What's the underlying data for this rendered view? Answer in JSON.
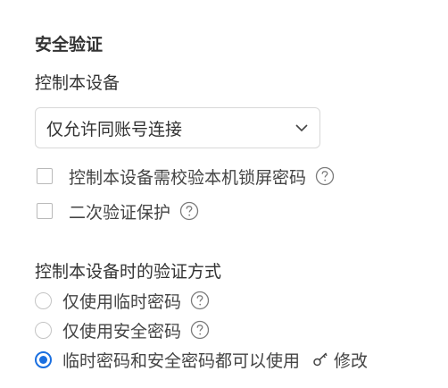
{
  "security": {
    "title": "安全验证",
    "control_device_label": "控制本设备",
    "dropdown": {
      "selected": "仅允许同账号连接"
    },
    "checkboxes": [
      {
        "label": "控制本设备需校验本机锁屏密码",
        "checked": false
      },
      {
        "label": "二次验证保护",
        "checked": false
      }
    ],
    "verification": {
      "title": "控制本设备时的验证方式",
      "options": [
        {
          "label": "仅使用临时密码",
          "selected": false
        },
        {
          "label": "仅使用安全密码",
          "selected": false
        },
        {
          "label": "临时密码和安全密码都可以使用",
          "selected": true
        }
      ],
      "modify_label": "修改"
    }
  },
  "colors": {
    "accent": "#1a6fe0",
    "text": "#333333",
    "border": "#d8d8d8"
  }
}
